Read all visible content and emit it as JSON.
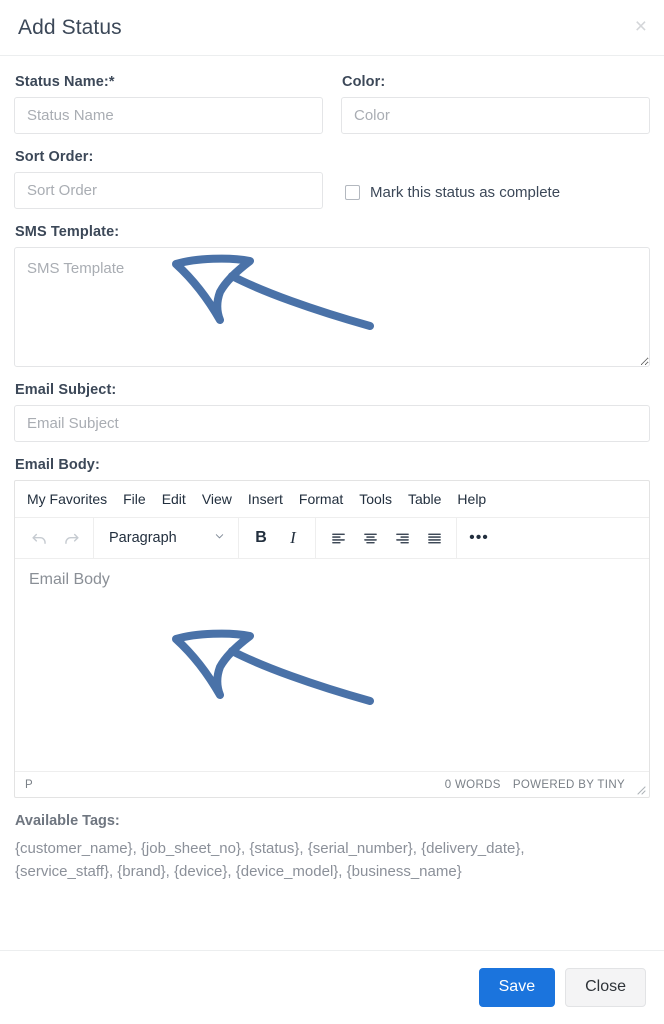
{
  "modal": {
    "title": "Add Status",
    "close_icon": "close-icon"
  },
  "form": {
    "status_name": {
      "label": "Status Name:*",
      "placeholder": "Status Name",
      "value": ""
    },
    "color": {
      "label": "Color:",
      "placeholder": "Color",
      "value": ""
    },
    "sort_order": {
      "label": "Sort Order:",
      "placeholder": "Sort Order",
      "value": ""
    },
    "mark_complete": {
      "label": "Mark this status as complete",
      "checked": false
    },
    "sms_template": {
      "label": "SMS Template:",
      "placeholder": "SMS Template",
      "value": ""
    },
    "email_subject": {
      "label": "Email Subject:",
      "placeholder": "Email Subject",
      "value": ""
    },
    "email_body": {
      "label": "Email Body:",
      "placeholder": "Email Body",
      "value": ""
    }
  },
  "editor": {
    "menubar": [
      {
        "label": "My Favorites"
      },
      {
        "label": "File"
      },
      {
        "label": "Edit"
      },
      {
        "label": "View"
      },
      {
        "label": "Insert"
      },
      {
        "label": "Format"
      },
      {
        "label": "Tools"
      },
      {
        "label": "Table"
      },
      {
        "label": "Help"
      }
    ],
    "toolbar": {
      "undo_icon": "undo-icon",
      "redo_icon": "redo-icon",
      "block_format": "Paragraph",
      "chevron_icon": "chevron-down-icon",
      "bold_label": "B",
      "italic_label": "I",
      "align_left_icon": "align-left-icon",
      "align_center_icon": "align-center-icon",
      "align_right_icon": "align-right-icon",
      "align_justify_icon": "align-justify-icon",
      "more_label": "•••"
    },
    "statusbar": {
      "path": "P",
      "word_count": "0 WORDS",
      "branding": "POWERED BY TINY",
      "resize_icon": "resize-handle-icon"
    }
  },
  "available_tags": {
    "title": "Available Tags:",
    "text": "{customer_name}, {job_sheet_no}, {status}, {serial_number}, {delivery_date}, {service_staff}, {brand}, {device}, {device_model}, {business_name}",
    "items": [
      "{customer_name}",
      "{job_sheet_no}",
      "{status}",
      "{serial_number}",
      "{delivery_date}",
      "{service_staff}",
      "{brand}",
      "{device}",
      "{device_model}",
      "{business_name}"
    ]
  },
  "footer": {
    "save_label": "Save",
    "close_label": "Close"
  },
  "annotations": [
    {
      "name": "arrow-to-sms-template",
      "color": "#4a72a8"
    },
    {
      "name": "arrow-to-email-body",
      "color": "#4a72a8"
    }
  ],
  "colors": {
    "primary": "#1b74dd",
    "label": "#3c4858",
    "annotation": "#4a72a8"
  }
}
